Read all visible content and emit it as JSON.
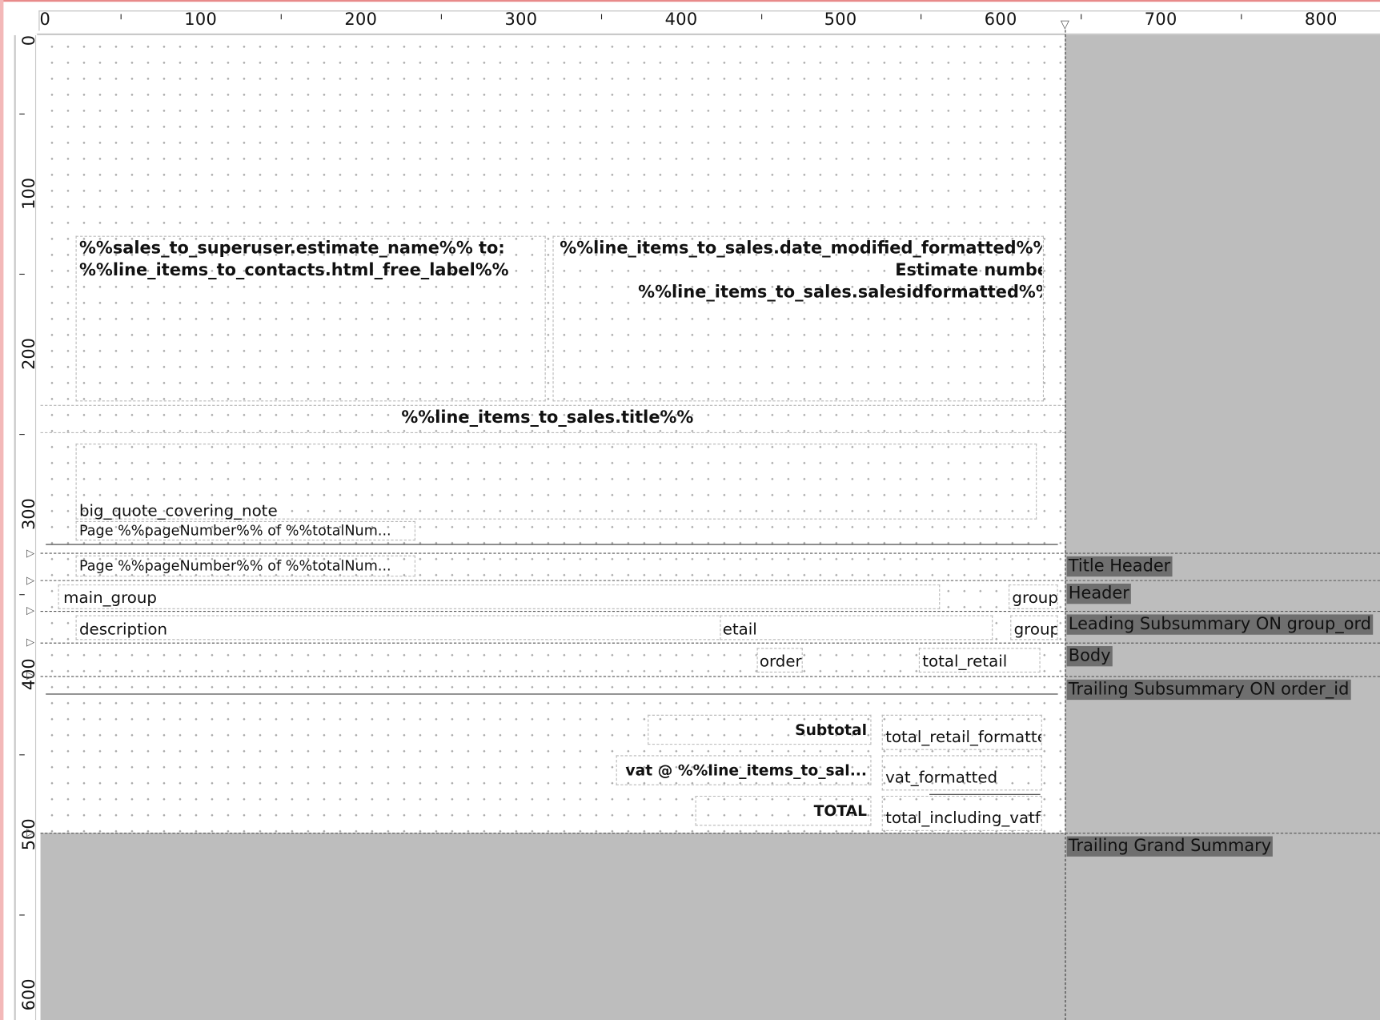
{
  "ruler": {
    "horizontal_labels": [
      "0",
      "100",
      "200",
      "300",
      "400",
      "500",
      "600",
      "700",
      "800"
    ],
    "vertical_labels": [
      "0",
      "100",
      "200",
      "300",
      "400",
      "500",
      "600"
    ]
  },
  "parts": {
    "title_header": "Title Header",
    "header": "Header",
    "leading_subsummary": "Leading Subsummary ON group_ord",
    "body": "Body",
    "trailing_subsummary": "Trailing Subsummary ON order_id",
    "trailing_grand_summary": "Trailing Grand Summary"
  },
  "title_area": {
    "recipient_line1": "%%sales_to_superuser.estimate_name%% to:",
    "recipient_line2": "%%line_items_to_contacts.html_free_label%%",
    "date_modified": "%%line_items_to_sales.date_modified_formatted%%",
    "estimate_number_label": "Estimate number",
    "sales_id": "%%line_items_to_sales.salesidformatted%%",
    "sales_title": "%%line_items_to_sales.title%%",
    "covering_note": "big_quote_covering_note",
    "page_number": "Page %%pageNumber%% of %%totalNum..."
  },
  "header_area": {
    "page_number": "Page %%pageNumber%% of %%totalNum..."
  },
  "leading_subsummary_area": {
    "main_group": "main_group",
    "group": "group"
  },
  "body_area": {
    "description": "description",
    "retail": "etail",
    "group": "group"
  },
  "trailing_subsummary_area": {
    "order": "order",
    "total_retail": "total_retail"
  },
  "grand_summary_area": {
    "subtotal_label": "Subtotal",
    "subtotal_value": "total_retail_formatted",
    "vat_label": "vat @ %%line_items_to_sal...",
    "vat_value": "vat_formatted",
    "total_label": "TOTAL",
    "total_value": "total_including_vatformatted"
  },
  "colors": {
    "gray_area": "#bdbdbd",
    "part_label_bg": "#6f6f6f"
  }
}
